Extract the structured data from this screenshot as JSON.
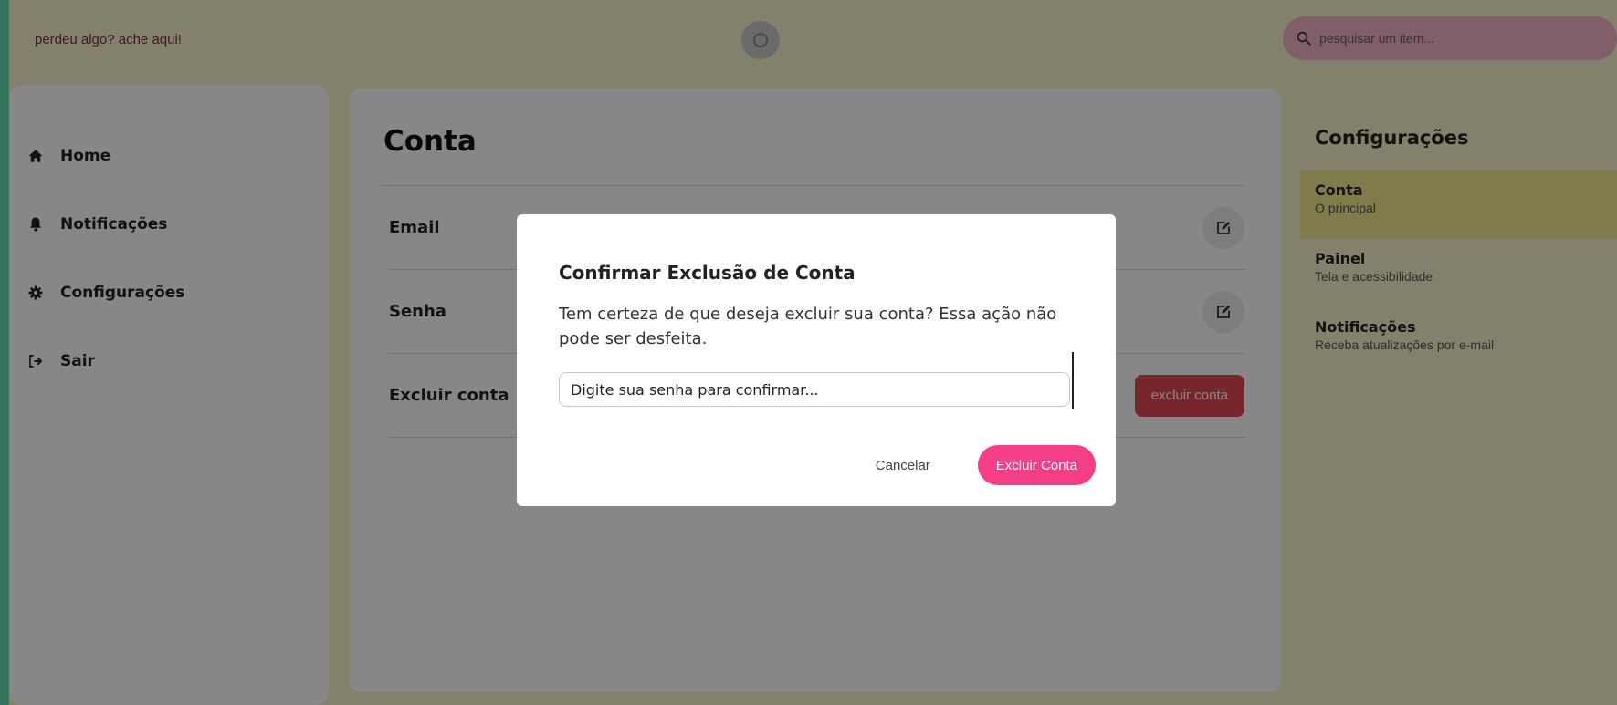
{
  "app": {
    "brand": "perdeu algo? ache aqui!",
    "search_placeholder": "pesquisar um item..."
  },
  "sidebar": {
    "items": [
      {
        "label": "Home",
        "icon": "home-icon"
      },
      {
        "label": "Notificações",
        "icon": "bell-icon"
      },
      {
        "label": "Configurações",
        "icon": "gear-icon"
      },
      {
        "label": "Sair",
        "icon": "logout-icon"
      }
    ]
  },
  "main": {
    "title": "Conta",
    "rows": [
      {
        "label": "Email",
        "action": "edit-icon"
      },
      {
        "label": "Senha",
        "action": "edit-icon"
      },
      {
        "label": "Excluir conta",
        "action_label": "excluir conta"
      }
    ]
  },
  "settings": {
    "title": "Configurações",
    "items": [
      {
        "title": "Conta",
        "subtitle": "O principal",
        "active": true
      },
      {
        "title": "Painel",
        "subtitle": "Tela e acessibilidade",
        "active": false
      },
      {
        "title": "Notificações",
        "subtitle": "Receba atualizações por e-mail",
        "active": false
      }
    ]
  },
  "modal": {
    "title": "Confirmar Exclusão de Conta",
    "message": "Tem certeza de que deseja excluir sua conta? Essa ação não pode ser desfeita.",
    "password_placeholder": "Digite sua senha para confirmar...",
    "cancel_label": "Cancelar",
    "confirm_label": "Excluir Conta"
  },
  "colors": {
    "accent": "#f43f87",
    "danger": "#e04a54",
    "background": "#f7f4cc",
    "active_setting": "#f0e88c",
    "search_bg": "#f2b3c4"
  }
}
